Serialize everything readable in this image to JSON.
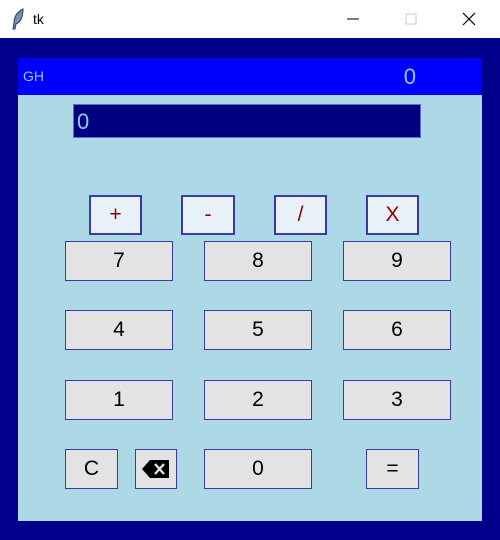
{
  "window": {
    "title": "tk",
    "icon": "feather-icon",
    "controls": [
      "minimize-icon",
      "maximize-icon",
      "close-icon"
    ]
  },
  "header": {
    "brand": "GH",
    "value": "0"
  },
  "display": {
    "value": "0"
  },
  "operators": {
    "add": "+",
    "subtract": "-",
    "divide": "/",
    "multiply": "X"
  },
  "keys": {
    "k7": "7",
    "k8": "8",
    "k9": "9",
    "k4": "4",
    "k5": "5",
    "k6": "6",
    "k1": "1",
    "k2": "2",
    "k3": "3",
    "clear": "C",
    "backspace_icon": "backspace-icon",
    "k0": "0",
    "equals": "="
  },
  "colors": {
    "frame": "#00008b",
    "panel": "#add8e6",
    "header_bar": "#0000ff",
    "display_bg": "#000080",
    "text_accent": "#87cefa",
    "operator_text": "#8b0000"
  }
}
